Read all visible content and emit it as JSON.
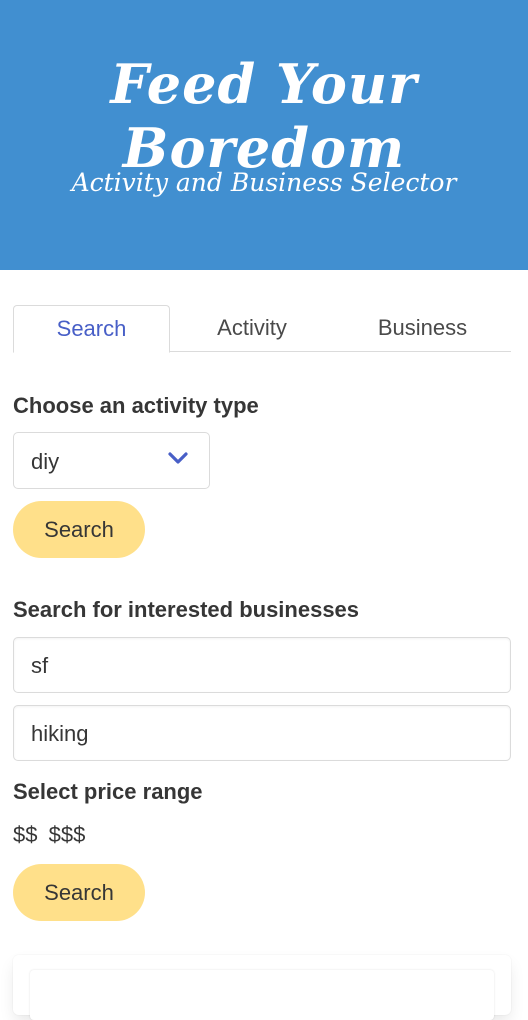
{
  "hero": {
    "title": "Feed Your Boredom",
    "subtitle": "Activity and Business Selector"
  },
  "tabs": [
    {
      "label": "Search",
      "active": true
    },
    {
      "label": "Activity",
      "active": false
    },
    {
      "label": "Business",
      "active": false
    }
  ],
  "activity_section": {
    "label": "Choose an activity type",
    "selected": "diy",
    "button_label": "Search"
  },
  "business_section": {
    "label": "Search for interested businesses",
    "location_value": "sf",
    "term_value": "hiking",
    "price_label": "Select price range",
    "price_options": [
      "$$",
      "$$$"
    ],
    "button_label": "Search"
  },
  "colors": {
    "hero_bg": "#418fd0",
    "accent": "#485fc7",
    "button_bg": "#ffe08a"
  },
  "icons": {
    "select_arrow": "chevron-down-icon"
  }
}
